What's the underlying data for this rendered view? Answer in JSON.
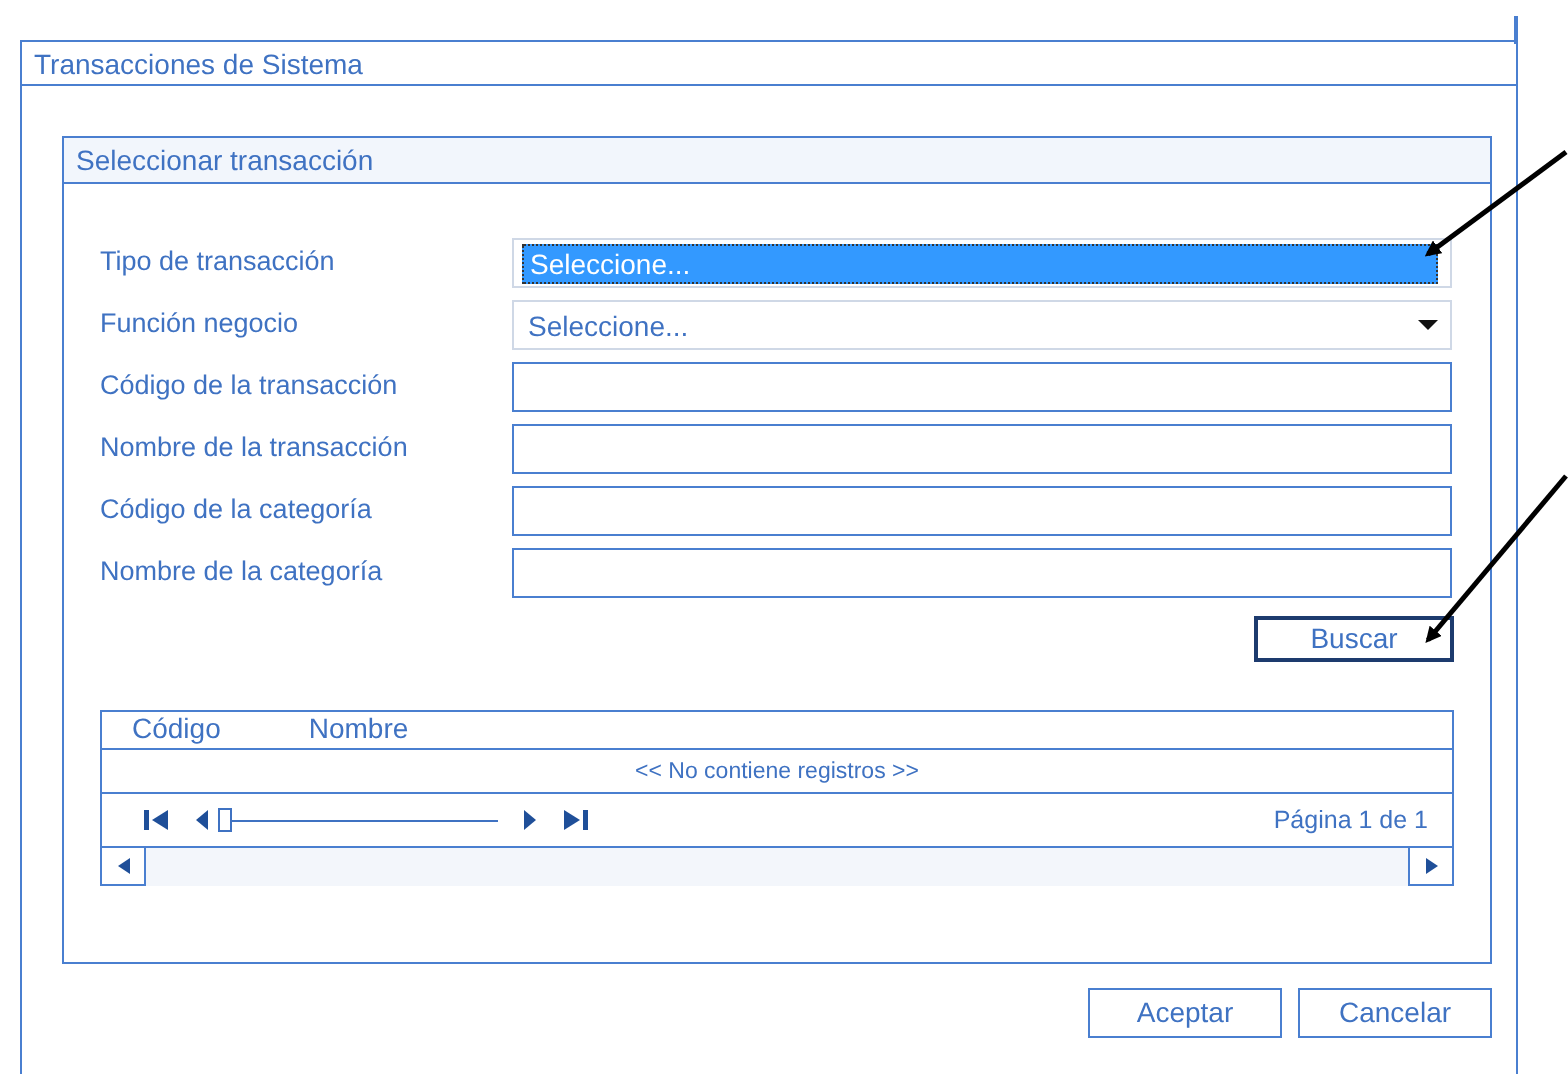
{
  "window": {
    "title": "Transacciones de Sistema"
  },
  "panel": {
    "title": "Seleccionar transacción"
  },
  "fields": [
    {
      "kind": "select",
      "label": "Tipo de transacción",
      "value": "Seleccione...",
      "highlighted": true
    },
    {
      "kind": "select",
      "label": "Función negocio",
      "value": "Seleccione...",
      "highlighted": false
    },
    {
      "kind": "text",
      "label": "Código de la transacción"
    },
    {
      "kind": "text",
      "label": "Nombre de la transacción"
    },
    {
      "kind": "text",
      "label": "Código de la categoría"
    },
    {
      "kind": "text",
      "label": "Nombre de la categoría"
    }
  ],
  "search_button": {
    "label": "Buscar",
    "focused": true
  },
  "table": {
    "columns": [
      "Código",
      "Nombre"
    ],
    "empty_message": "<< No contiene registros >>",
    "pager": {
      "level": 0,
      "page_text": "Página 1 de 1"
    }
  },
  "buttons": [
    "Aceptar",
    "Cancelar"
  ]
}
